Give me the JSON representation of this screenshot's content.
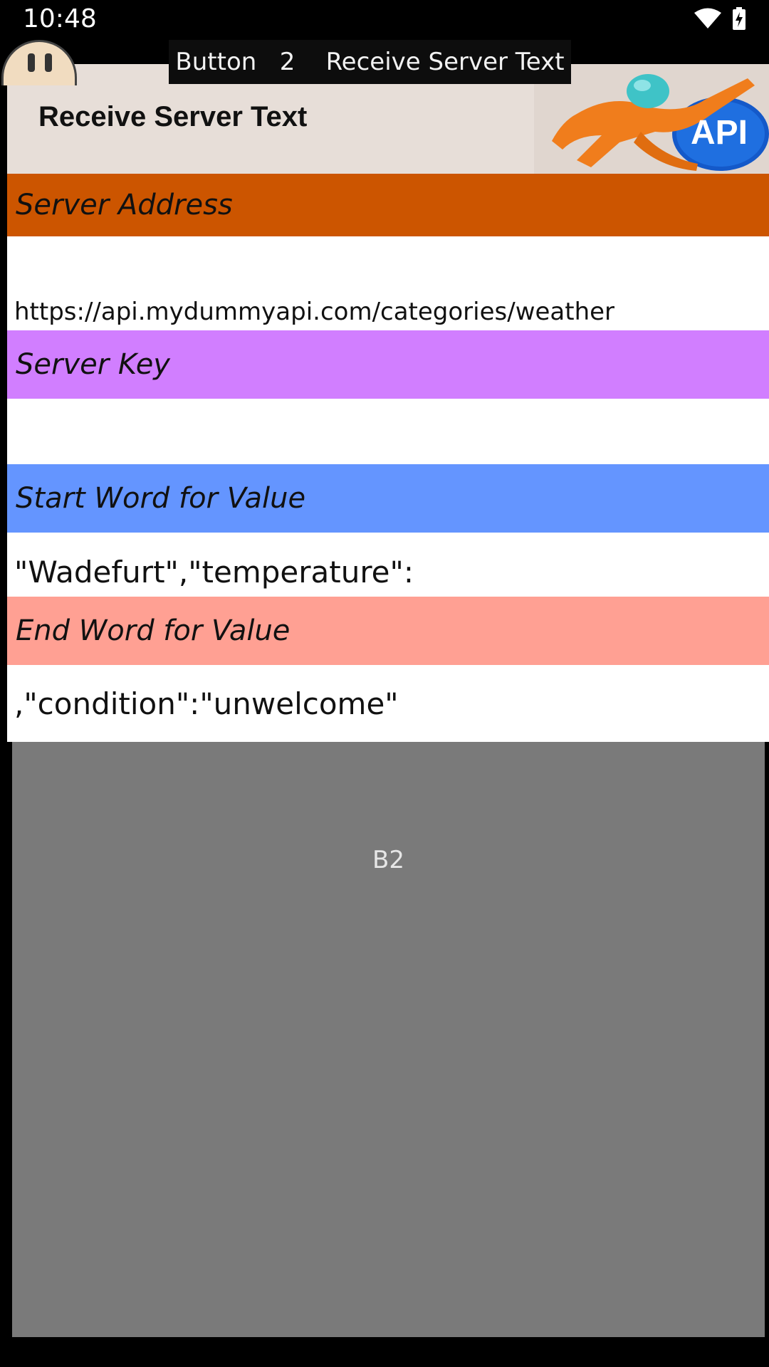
{
  "status_bar": {
    "time": "10:48",
    "icons": [
      "wifi-icon",
      "battery-charging-icon"
    ]
  },
  "toast": {
    "text": "Button   2    Receive Server Text"
  },
  "header": {
    "title": "Receive Server Text",
    "logo_text": "API"
  },
  "sections": {
    "server_address": {
      "label": "Server Address",
      "value": "https://api.mydummyapi.com/categories/weather",
      "color": "#cc5500"
    },
    "server_key": {
      "label": "Server Key",
      "value": "",
      "color": "#d17eff"
    },
    "start_word": {
      "label": "Start Word for Value",
      "value": "\"Wadefurt\",\"temperature\":",
      "color": "#6495ff"
    },
    "end_word": {
      "label": "End Word for Value",
      "value": ",\"condition\":\"unwelcome\"",
      "color": "#ffa093"
    }
  },
  "button_area": {
    "label": "B2"
  },
  "floating_button": {
    "icon": "face-icon"
  }
}
